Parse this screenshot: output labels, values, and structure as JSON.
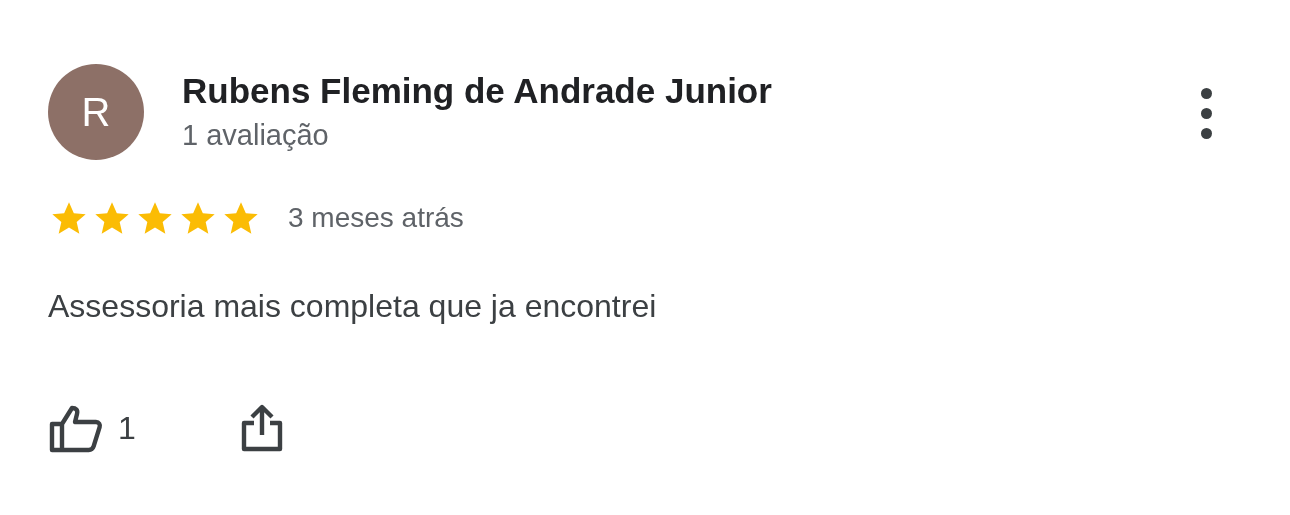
{
  "review": {
    "author": "Rubens Fleming de Andrade Junior",
    "avatar_letter": "R",
    "subtitle": "1 avaliação",
    "stars": 5,
    "time": "3 meses atrás",
    "text": "Assessoria mais completa que ja encontrei",
    "likes": "1"
  }
}
